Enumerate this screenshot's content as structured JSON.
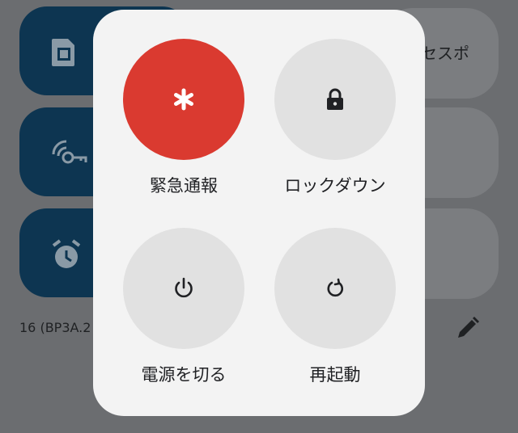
{
  "background": {
    "partial_tile_text": "セスポ",
    "build_text": "16 (BP3A.2",
    "icons": [
      "sim-card-icon",
      "vpn-key-icon",
      "alarm-icon",
      "edit-pencil-icon"
    ]
  },
  "power_menu": {
    "actions": [
      {
        "label": "緊急通報",
        "icon": "asterisk-icon",
        "color": "#da3a30"
      },
      {
        "label": "ロックダウン",
        "icon": "lock-icon"
      },
      {
        "label": "電源を切る",
        "icon": "power-icon"
      },
      {
        "label": "再起動",
        "icon": "restart-icon"
      }
    ]
  }
}
